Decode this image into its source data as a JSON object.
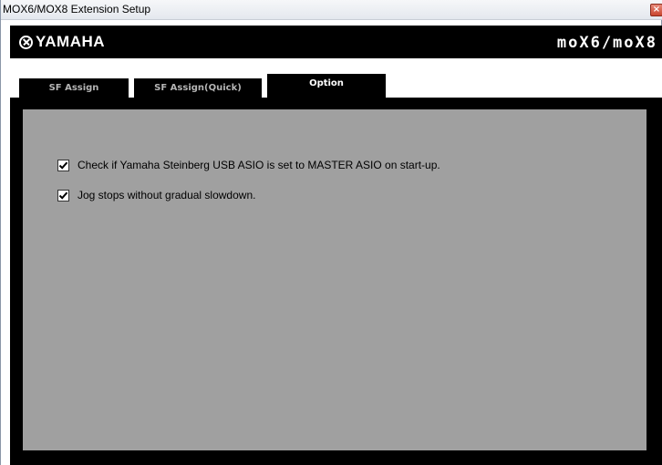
{
  "window": {
    "title": "MOX6/MOX8 Extension Setup",
    "close_glyph": "×"
  },
  "header": {
    "brand": "YAMAHA",
    "product": "moX6/moX8",
    "brand_icon": "yamaha-tuning-fork-emblem-icon"
  },
  "tabs": [
    {
      "label": "SF Assign",
      "active": false
    },
    {
      "label": "SF Assign(Quick)",
      "active": false
    },
    {
      "label": "Option",
      "active": true
    }
  ],
  "options": [
    {
      "label": "Check if Yamaha Steinberg USB ASIO is set to MASTER ASIO on start-up.",
      "checked": true
    },
    {
      "label": "Jog stops without gradual slowdown.",
      "checked": true
    }
  ],
  "colors": {
    "panel_background": "#a0a0a0",
    "frame": "#000000",
    "tab_active_text": "#ffffff",
    "tab_inactive_text": "#b5b5b5"
  }
}
